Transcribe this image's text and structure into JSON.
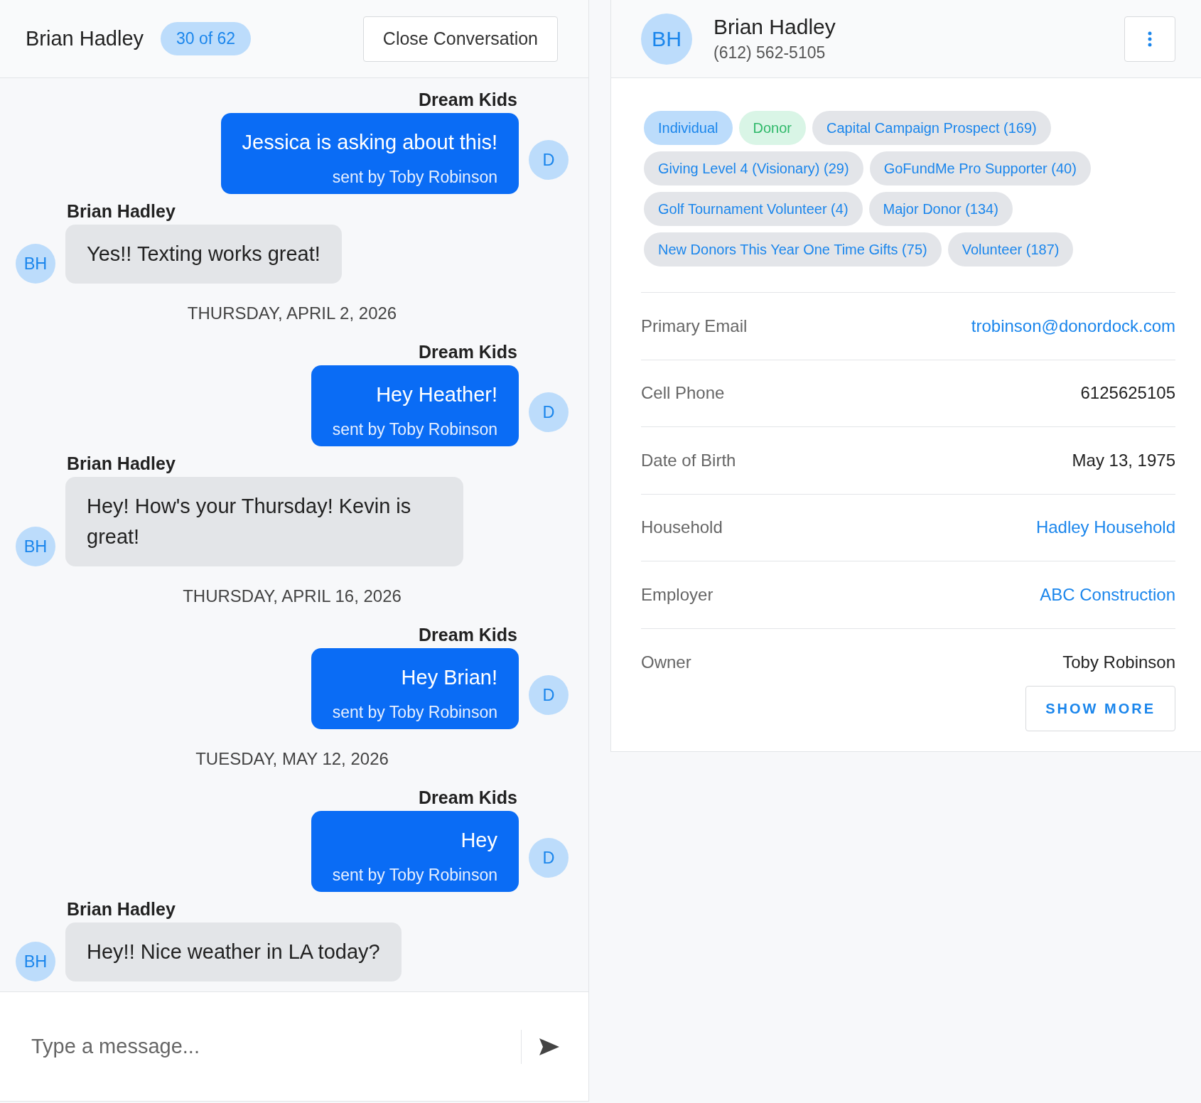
{
  "conversation": {
    "contact_name": "Brian Hadley",
    "position_badge": "30 of 62",
    "close_button": "Close Conversation"
  },
  "messages": [
    {
      "kind": "message",
      "outgoing": true,
      "sender": "Dream Kids",
      "text": "Jessica is asking about this!",
      "sent_by": "sent by Toby Robinson",
      "avatar": "D"
    },
    {
      "kind": "message",
      "outgoing": false,
      "sender": "Brian Hadley",
      "text": "Yes!! Texting works great!",
      "avatar": "BH"
    },
    {
      "kind": "date",
      "text": "THURSDAY, APRIL 2, 2026"
    },
    {
      "kind": "message",
      "outgoing": true,
      "sender": "Dream Kids",
      "text": "Hey Heather!",
      "sent_by": "sent by Toby Robinson",
      "avatar": "D"
    },
    {
      "kind": "message",
      "outgoing": false,
      "sender": "Brian Hadley",
      "text": "Hey! How's your Thursday! Kevin is great!",
      "avatar": "BH"
    },
    {
      "kind": "date",
      "text": "THURSDAY, APRIL 16, 2026"
    },
    {
      "kind": "message",
      "outgoing": true,
      "sender": "Dream Kids",
      "text": "Hey Brian!",
      "sent_by": "sent by Toby Robinson",
      "avatar": "D"
    },
    {
      "kind": "date",
      "text": "TUESDAY, MAY 12, 2026"
    },
    {
      "kind": "message",
      "outgoing": true,
      "sender": "Dream Kids",
      "text": "Hey",
      "sent_by": "sent by Toby Robinson",
      "avatar": "D"
    },
    {
      "kind": "message",
      "outgoing": false,
      "sender": "Brian Hadley",
      "text": "Hey!! Nice weather in LA today?",
      "avatar": "BH"
    }
  ],
  "composer": {
    "placeholder": "Type a message..."
  },
  "contact": {
    "avatar": "BH",
    "name": "Brian Hadley",
    "phone": "(612) 562-5105",
    "tags": [
      {
        "label": "Individual",
        "kind": "type"
      },
      {
        "label": "Donor",
        "kind": "status"
      },
      {
        "label": "Capital Campaign Prospect (169)",
        "kind": "group"
      },
      {
        "label": "Giving Level 4 (Visionary) (29)",
        "kind": "group"
      },
      {
        "label": "GoFundMe Pro Supporter (40)",
        "kind": "group"
      },
      {
        "label": "Golf Tournament Volunteer (4)",
        "kind": "group"
      },
      {
        "label": "Major Donor (134)",
        "kind": "group"
      },
      {
        "label": "New Donors This Year One Time Gifts (75)",
        "kind": "group"
      },
      {
        "label": "Volunteer (187)",
        "kind": "group"
      }
    ],
    "fields": [
      {
        "label": "Primary Email",
        "value": "trobinson@donordock.com",
        "link": true
      },
      {
        "label": "Cell Phone",
        "value": "6125625105",
        "link": false
      },
      {
        "label": "Date of Birth",
        "value": "May 13, 1975",
        "link": false
      },
      {
        "label": "Household",
        "value": "Hadley Household",
        "link": true
      },
      {
        "label": "Employer",
        "value": "ABC Construction",
        "link": true
      },
      {
        "label": "Owner",
        "value": "Toby Robinson",
        "link": false
      }
    ],
    "show_more": "SHOW MORE"
  }
}
